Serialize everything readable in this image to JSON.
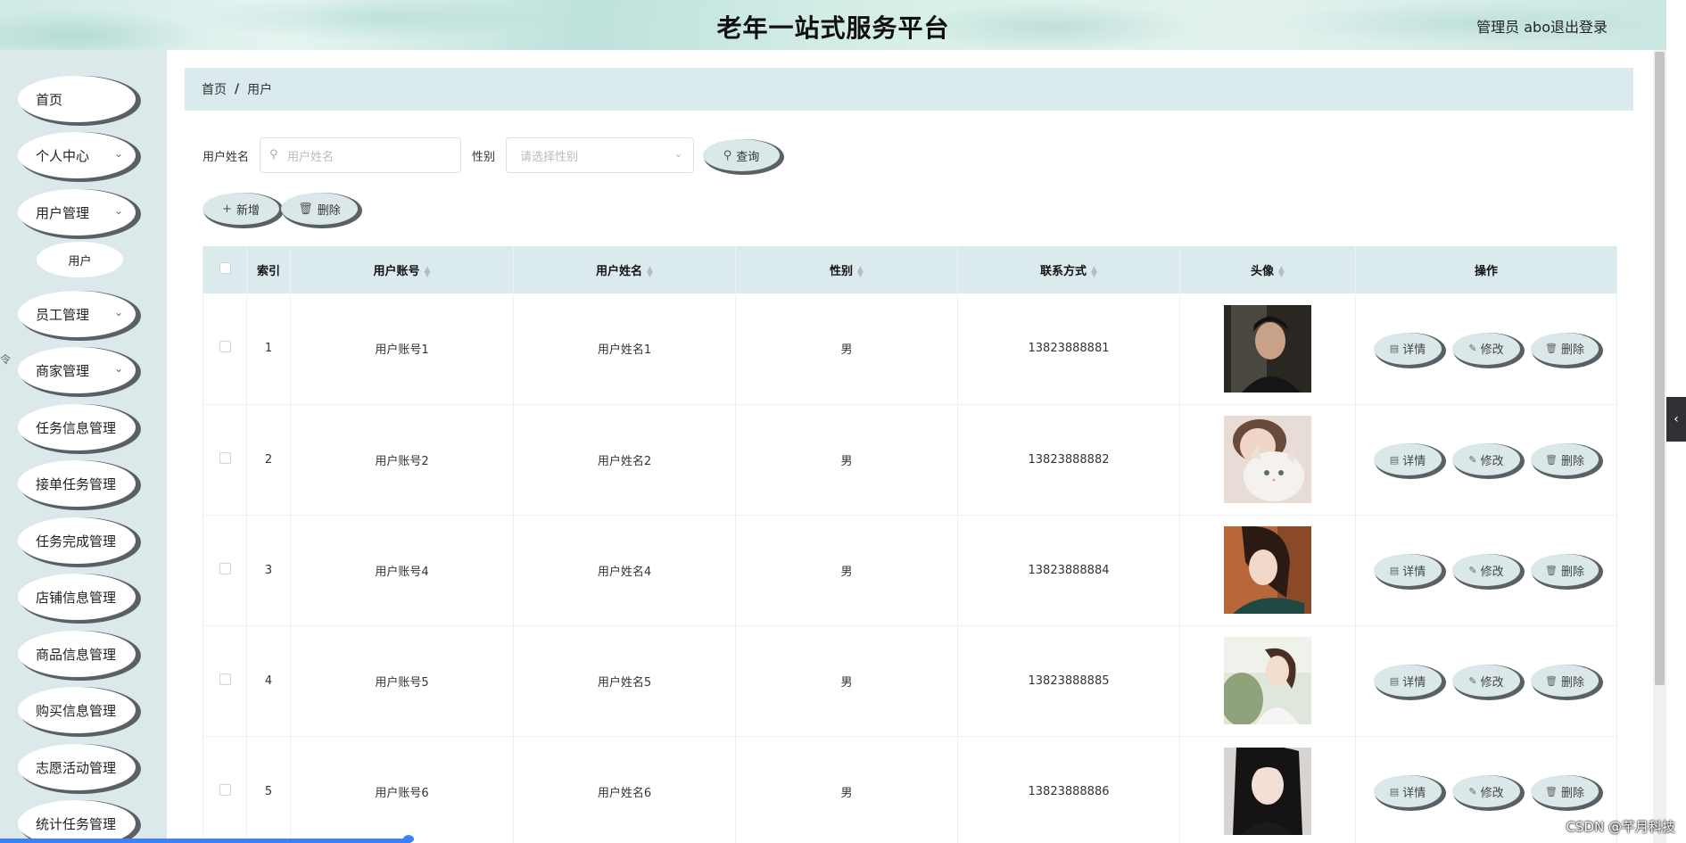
{
  "header": {
    "title": "老年一站式服务平台",
    "user": "管理员 abo",
    "logout": "退出登录"
  },
  "sidebar": {
    "items": [
      {
        "label": "首页"
      },
      {
        "label": "个人中心",
        "expand": "⌄"
      },
      {
        "label": "用户管理",
        "expand": "⌄"
      },
      {
        "label": "员工管理",
        "expand": "⌄"
      },
      {
        "label": "商家管理",
        "expand": "⌄"
      },
      {
        "label": "任务信息管理"
      },
      {
        "label": "接单任务管理"
      },
      {
        "label": "任务完成管理"
      },
      {
        "label": "店铺信息管理"
      },
      {
        "label": "商品信息管理"
      },
      {
        "label": "购买信息管理"
      },
      {
        "label": "志愿活动管理"
      },
      {
        "label": "统计任务管理"
      }
    ],
    "sub_item": "用户",
    "edge_mark": "令"
  },
  "breadcrumb": {
    "home": "首页",
    "sep": "/",
    "current": "用户"
  },
  "search": {
    "name_label": "用户姓名",
    "name_placeholder": "用户姓名",
    "sex_label": "性别",
    "sex_placeholder": "请选择性别",
    "query_label": "查询"
  },
  "actions": {
    "add_label": "新增",
    "delete_label": "删除"
  },
  "table": {
    "headers": {
      "index": "索引",
      "account": "用户账号",
      "name": "用户姓名",
      "sex": "性别",
      "contact": "联系方式",
      "avatar": "头像",
      "ops": "操作"
    },
    "rows": [
      {
        "index": "1",
        "account": "用户账号1",
        "name": "用户姓名1",
        "sex": "男",
        "contact": "13823888881"
      },
      {
        "index": "2",
        "account": "用户账号2",
        "name": "用户姓名2",
        "sex": "男",
        "contact": "13823888882"
      },
      {
        "index": "3",
        "account": "用户账号4",
        "name": "用户姓名4",
        "sex": "男",
        "contact": "13823888884"
      },
      {
        "index": "4",
        "account": "用户账号5",
        "name": "用户姓名5",
        "sex": "男",
        "contact": "13823888885"
      },
      {
        "index": "5",
        "account": "用户账号6",
        "name": "用户姓名6",
        "sex": "男",
        "contact": "13823888886"
      }
    ],
    "row_actions": {
      "detail": "详情",
      "edit": "修改",
      "delete": "删除"
    }
  },
  "watermark": "CSDN @芊月科技",
  "colors": {
    "panel": "#dbeaec",
    "sidebar": "#dbe9eb",
    "button_shadow": "#5a6064",
    "accent_blue": "#3b82f6"
  }
}
